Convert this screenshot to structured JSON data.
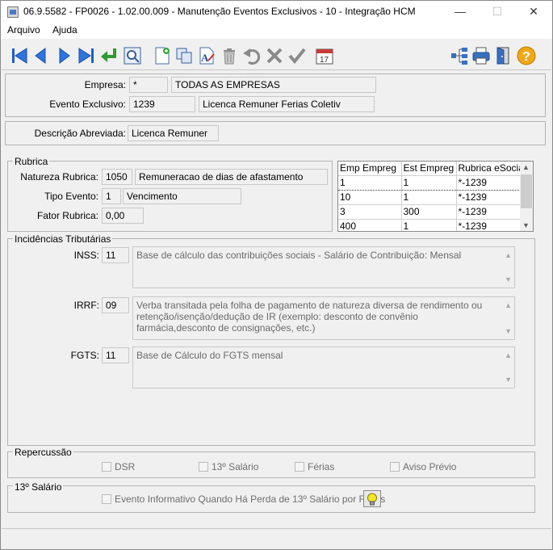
{
  "window": {
    "title": "06.9.5582 - FP0026 - 1.02.00.009 - Manutenção Eventos Exclusivos - 10 - Integração HCM",
    "minimize": "—",
    "maximize": "☐",
    "close": "✕"
  },
  "menu": {
    "items": [
      {
        "label": "Arquivo"
      },
      {
        "label": "Ajuda"
      }
    ]
  },
  "toolbar": {
    "icons": [
      "first-record-icon",
      "previous-record-icon",
      "next-record-icon",
      "last-record-icon",
      "return-icon",
      "search-icon",
      "new-icon",
      "copy-icon",
      "edit-icon",
      "delete-icon",
      "undo-icon",
      "cancel-icon",
      "confirm-icon",
      "calendar-icon",
      "tree-icon",
      "print-icon",
      "exit-icon",
      "help-icon"
    ],
    "calendar_day": "17",
    "help_glyph": "?"
  },
  "header": {
    "empresa_label": "Empresa:",
    "empresa_code": "*",
    "empresa_name": "TODAS AS EMPRESAS",
    "evento_label": "Evento Exclusivo:",
    "evento_code": "1239",
    "evento_name": "Licenca Remuner Ferias Coletiv"
  },
  "descricao": {
    "label": "Descrição Abreviada:",
    "value": "Licenca Remuner"
  },
  "rubrica": {
    "title": "Rubrica",
    "natureza_label": "Natureza Rubrica:",
    "natureza_code": "1050",
    "natureza_desc": "Remuneracao de dias de afastamento",
    "tipo_label": "Tipo Evento:",
    "tipo_code": "1",
    "tipo_desc": "Vencimento",
    "fator_label": "Fator Rubrica:",
    "fator_value": "0,00"
  },
  "grid": {
    "columns": [
      "Emp Empreg",
      "Est Empreg",
      "Rubrica eSocial"
    ],
    "rows": [
      [
        "1",
        "1",
        "*-1239"
      ],
      [
        "10",
        "1",
        "*-1239"
      ],
      [
        "3",
        "300",
        "*-1239"
      ],
      [
        "400",
        "1",
        "*-1239"
      ]
    ]
  },
  "incidencias": {
    "title": "Incidências Tributárias",
    "inss_label": "INSS:",
    "inss_code": "11",
    "inss_desc": "Base de cálculo das contribuições sociais - Salário de Contribuição: Mensal",
    "irrf_label": "IRRF:",
    "irrf_code": "09",
    "irrf_desc": "Verba transitada pela folha de pagamento de natureza diversa de rendimento ou retenção/isenção/dedução de IR (exemplo: desconto de convênio farmácia,desconto de consignações, etc.)",
    "fgts_label": "FGTS:",
    "fgts_code": "11",
    "fgts_desc": "Base de Cálculo do FGTS mensal"
  },
  "repercussao": {
    "title": "Repercussão",
    "dsr": "DSR",
    "salario13": "13º Salário",
    "ferias": "Férias",
    "aviso": "Aviso Prévio"
  },
  "decimo": {
    "title": "13º Salário",
    "evento_informativo": "Evento Informativo Quando Há Perda de 13º Salário por Faltas"
  }
}
